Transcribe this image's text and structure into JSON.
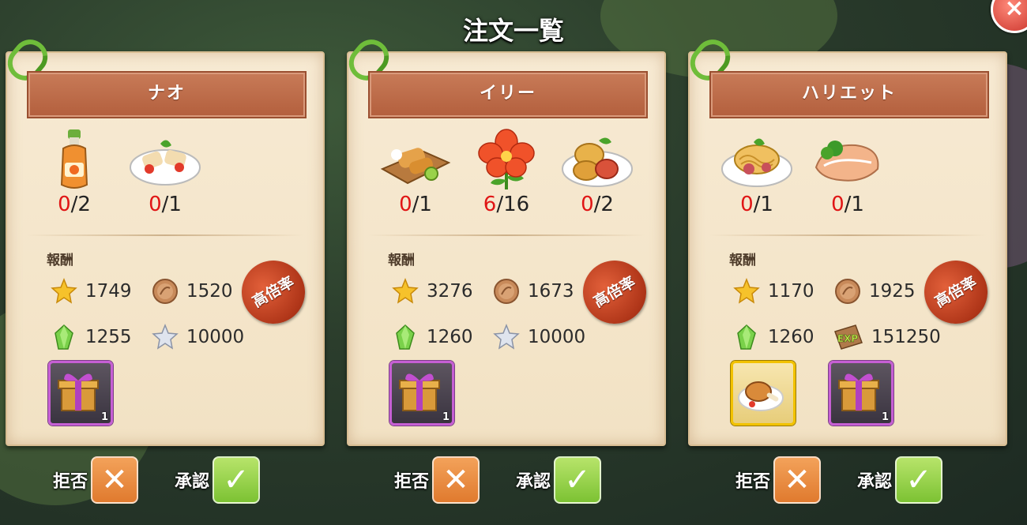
{
  "screen": {
    "title": "注文一覧"
  },
  "labels": {
    "reward": "報酬",
    "seal": "高倍率",
    "reject": "拒否",
    "accept": "承認"
  },
  "icons": {
    "close": "close-icon",
    "reject": "x-icon",
    "accept": "check-icon"
  },
  "cards": [
    {
      "customer": "ナオ",
      "items": [
        {
          "icon": "juice-bottle-icon",
          "have": "0",
          "need": "/2"
        },
        {
          "icon": "spring-rolls-plate-icon",
          "have": "0",
          "need": "/1"
        }
      ],
      "rewards": {
        "star": "1749",
        "coin": "1520",
        "gem": "1255",
        "silver_star": "10000"
      },
      "gifts": [
        {
          "icon": "gift-box-icon",
          "count": "1"
        }
      ]
    },
    {
      "customer": "イリー",
      "items": [
        {
          "icon": "fried-fish-board-icon",
          "have": "0",
          "need": "/1"
        },
        {
          "icon": "hibiscus-flower-icon",
          "have": "6",
          "need": "/16"
        },
        {
          "icon": "croquette-plate-icon",
          "have": "0",
          "need": "/2"
        }
      ],
      "rewards": {
        "star": "3276",
        "coin": "1673",
        "gem": "1260",
        "silver_star": "10000"
      },
      "gifts": [
        {
          "icon": "gift-box-icon",
          "count": "1"
        }
      ]
    },
    {
      "customer": "ハリエット",
      "items": [
        {
          "icon": "pasta-plate-icon",
          "have": "0",
          "need": "/1"
        },
        {
          "icon": "salmon-steak-icon",
          "have": "0",
          "need": "/1"
        }
      ],
      "rewards": {
        "star": "1170",
        "coin": "1925",
        "gem": "1260",
        "exp_label": "EXP",
        "exp": "151250"
      },
      "gifts": [
        {
          "icon": "roast-chicken-icon",
          "count": ""
        },
        {
          "icon": "gift-box-icon",
          "count": "1"
        }
      ]
    }
  ]
}
